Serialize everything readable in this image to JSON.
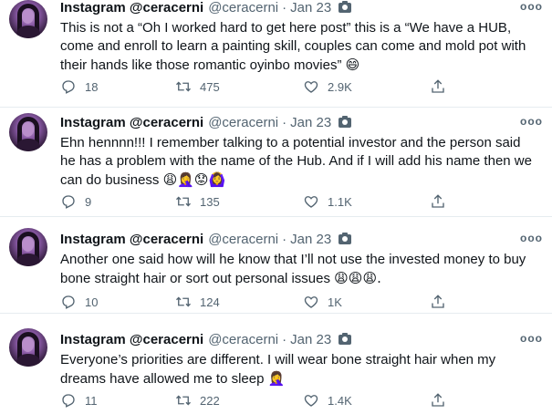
{
  "tweets": [
    {
      "display_name": "Instagram @ceracerni",
      "handle": "@ceracerni",
      "separator": "·",
      "time": "Jan 23",
      "text": "This is not a “Oh I worked hard to get here post” this is a “We have a HUB, come and enroll to learn a painting skill, couples can come and mold pot with their hands like those romantic oyinbo movies”",
      "emoji": "😄",
      "reply_count": "18",
      "retweet_count": "475",
      "like_count": "2.9K"
    },
    {
      "display_name": "Instagram @ceracerni",
      "handle": "@ceracerni",
      "separator": "·",
      "time": "Jan 23",
      "text": "Ehn hennnn!!! I remember talking to a potential investor and the person said he has a problem with the name of the Hub. And if I will add his name then we can do business",
      "emoji": "😩🤦‍♀️😟🙆‍♀️",
      "reply_count": "9",
      "retweet_count": "135",
      "like_count": "1.1K"
    },
    {
      "display_name": "Instagram @ceracerni",
      "handle": "@ceracerni",
      "separator": "·",
      "time": "Jan 23",
      "text": "Another one said how will he know that I’ll not use the invested money to buy bone straight hair or sort out personal issues",
      "emoji": "😩😩😩.",
      "reply_count": "10",
      "retweet_count": "124",
      "like_count": "1K"
    },
    {
      "display_name": "Instagram @ceracerni",
      "handle": "@ceracerni",
      "separator": "·",
      "time": "Jan 23",
      "text": "Everyone’s priorities are different. I will wear bone straight hair when my dreams have allowed me to sleep",
      "emoji": "🤦‍♀️",
      "reply_count": "11",
      "retweet_count": "222",
      "like_count": "1.4K"
    }
  ],
  "icons": {
    "reply": "reply-icon",
    "retweet": "retweet-icon",
    "like": "heart-icon",
    "share": "share-icon",
    "more": "more-icon",
    "camera": "camera-icon"
  },
  "more_glyph": "ooo"
}
